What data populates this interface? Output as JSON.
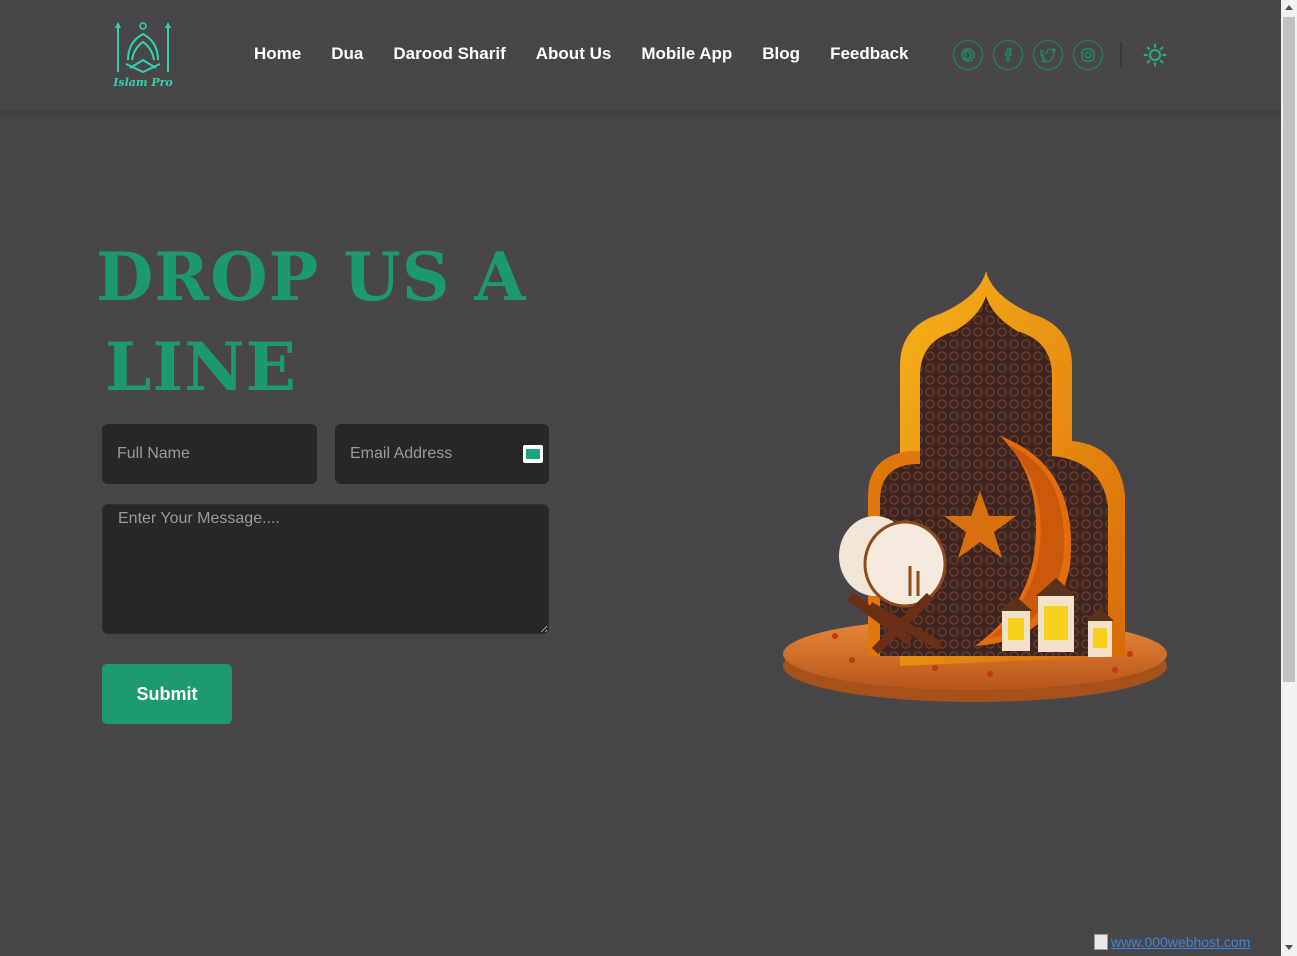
{
  "header": {
    "logo_text": "Islam Pro",
    "nav": [
      "Home",
      "Dua",
      "Darood Sharif",
      "About Us",
      "Mobile App",
      "Blog",
      "Feedback"
    ],
    "socials": [
      "dribbble-icon",
      "facebook-icon",
      "twitter-icon",
      "instagram-icon"
    ],
    "theme_toggle_icon": "sun-icon"
  },
  "main": {
    "heading_line1": "DROP US A",
    "heading_line2": "LINE",
    "full_name_placeholder": "Full Name",
    "email_placeholder": "Email Address",
    "message_placeholder": "Enter Your Message....",
    "submit_label": "Submit"
  },
  "footer": {
    "hosting_link": "www.000webhost.com"
  },
  "colors": {
    "background": "#484648",
    "accent": "#1e9a6f",
    "input_bg": "#272727"
  }
}
